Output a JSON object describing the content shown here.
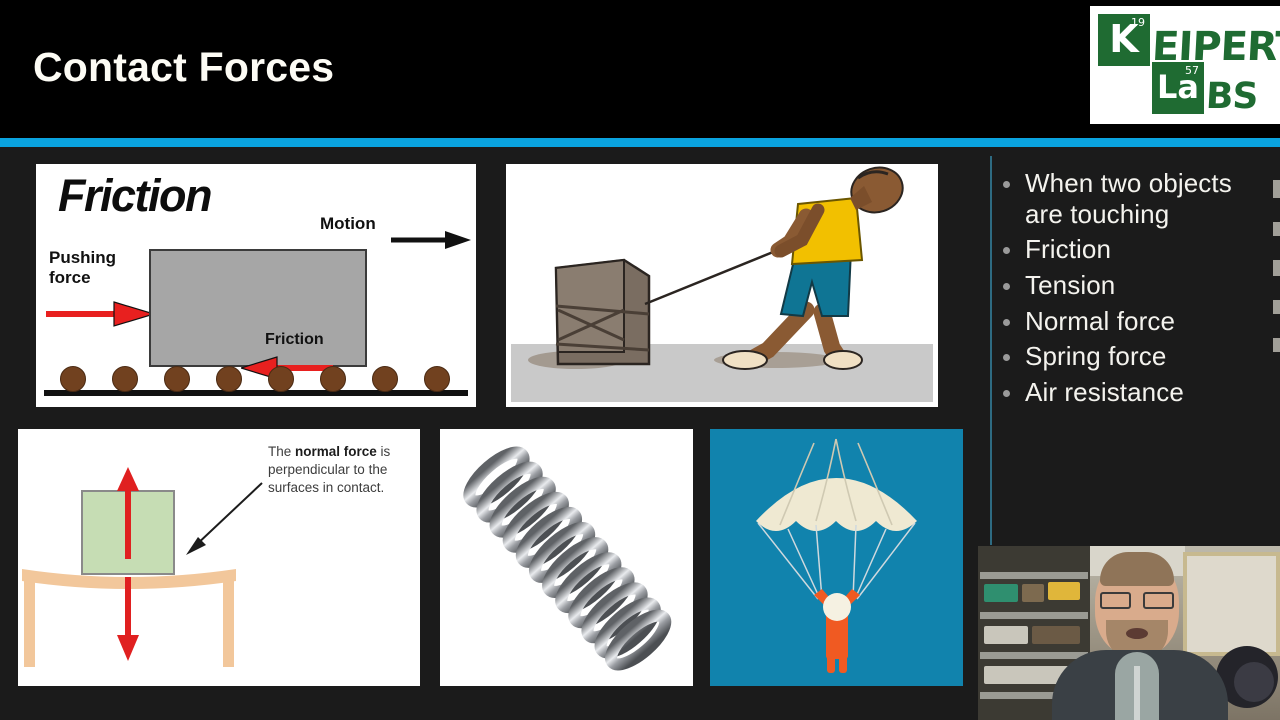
{
  "slide": {
    "title": "Contact Forces",
    "accent_color": "#0aa3df",
    "background_color": "#1b1b1b",
    "header_background": "#000000"
  },
  "logo": {
    "element_1": {
      "symbol": "K",
      "number": "19"
    },
    "word_1": "EIPERT'S",
    "element_2": {
      "symbol": "La",
      "number": "57"
    },
    "word_2": "BS",
    "brand_color": "#1f6b32"
  },
  "bullets": [
    {
      "text": "When two objects are touching"
    },
    {
      "text": "Friction"
    },
    {
      "text": "Tension"
    },
    {
      "text": "Normal force"
    },
    {
      "text": "Spring force"
    },
    {
      "text": "Air resistance"
    }
  ],
  "images": {
    "friction": {
      "name": "friction-diagram",
      "title": "Friction",
      "motion_label": "Motion",
      "pushing_label": "Pushing force",
      "friction_label": "Friction",
      "box_color": "#a6a6a6",
      "arrow_color": "#e8201f",
      "ball_color": "#71411f"
    },
    "tension": {
      "name": "tension-rope-pulling-box",
      "shirt_color": "#f2c000",
      "shorts_color": "#0f7594",
      "skin_color": "#8a5a33",
      "box_color": "#7a6d61",
      "floor_color": "#c9c9c9"
    },
    "normal_force": {
      "name": "normal-force-diagram",
      "caption_prefix": "The ",
      "caption_bold": "normal force",
      "caption_suffix": " is perpendicular to the surfaces in contact.",
      "block_color": "#c6ddb4",
      "table_color": "#f2c79b",
      "arrow_color": "#e02020"
    },
    "spring": {
      "name": "metal-coil-spring",
      "coil_color": "#8d8f93"
    },
    "parachute": {
      "name": "parachute-air-resistance",
      "background_color": "#1183ad",
      "canopy_color": "#efe9d2",
      "figure_color": "#f05a22"
    }
  },
  "webcam": {
    "name": "presenter-webcam-overlay",
    "description": "presenter on camera"
  }
}
